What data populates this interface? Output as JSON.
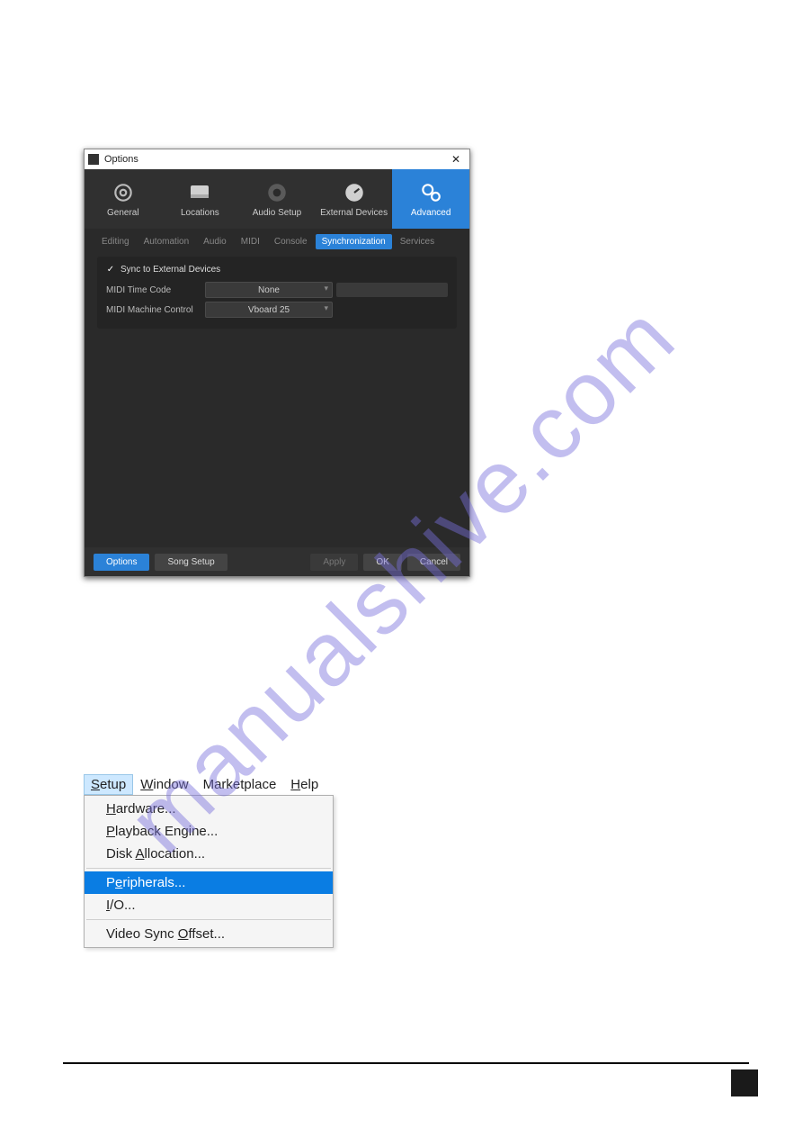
{
  "watermark": "manualshive.com",
  "options": {
    "title": "Options",
    "categories": {
      "general": "General",
      "locations": "Locations",
      "audio_setup": "Audio Setup",
      "external_devices": "External Devices",
      "advanced": "Advanced"
    },
    "tabs": {
      "editing": "Editing",
      "automation": "Automation",
      "audio": "Audio",
      "midi": "MIDI",
      "console": "Console",
      "synchronization": "Synchronization",
      "services": "Services"
    },
    "sync": {
      "checkbox_label": "Sync to External Devices",
      "midi_time_code_label": "MIDI Time Code",
      "midi_time_code_value": "None",
      "midi_machine_control_label": "MIDI Machine Control",
      "midi_machine_control_value": "Vboard 25"
    },
    "footer": {
      "options": "Options",
      "song_setup": "Song Setup",
      "apply": "Apply",
      "ok": "OK",
      "cancel": "Cancel"
    }
  },
  "menu": {
    "bar": {
      "setup": "Setup",
      "window": "Window",
      "marketplace": "Marketplace",
      "help": "Help"
    },
    "items": {
      "hardware": "Hardware...",
      "playback": "Playback Engine...",
      "disk": "Disk Allocation...",
      "peripherals": "Peripherals...",
      "io": "I/O...",
      "video_sync": "Video Sync Offset..."
    }
  }
}
